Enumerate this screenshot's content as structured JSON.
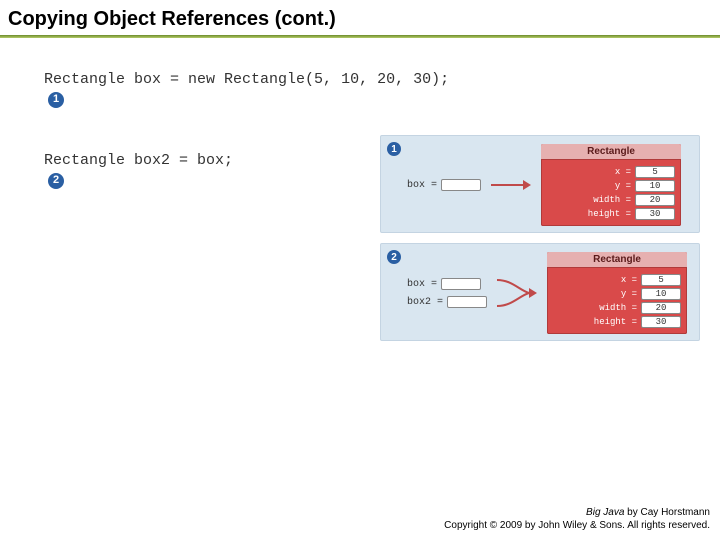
{
  "title": "Copying Object References (cont.)",
  "code": {
    "line1": "Rectangle box = new Rectangle(5, 10, 20, 30);",
    "line2": "Rectangle box2 = box;"
  },
  "markers": {
    "m1": "1",
    "m2": "2"
  },
  "diagram": {
    "classLabel": "Rectangle",
    "vars": {
      "box": "box =",
      "box2": "box2 ="
    },
    "fields": {
      "x": {
        "name": "x =",
        "val": "5"
      },
      "y": {
        "name": "y =",
        "val": "10"
      },
      "width": {
        "name": "width =",
        "val": "20"
      },
      "height": {
        "name": "height =",
        "val": "30"
      }
    }
  },
  "footer": {
    "book": "Big Java",
    "author": " by Cay Horstmann",
    "copyright": "Copyright © 2009 by John Wiley & Sons. All rights reserved."
  }
}
